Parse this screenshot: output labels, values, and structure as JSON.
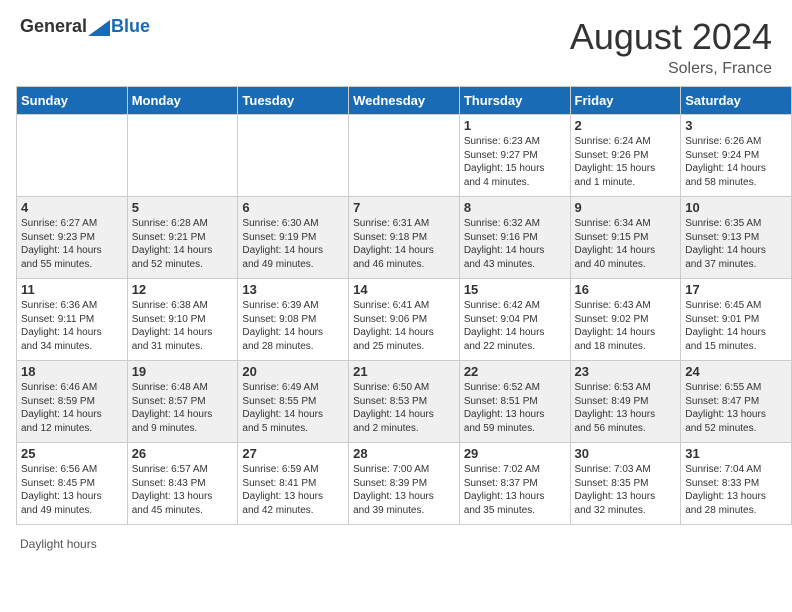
{
  "header": {
    "logo_general": "General",
    "logo_blue": "Blue",
    "month_year": "August 2024",
    "location": "Solers, France"
  },
  "days_of_week": [
    "Sunday",
    "Monday",
    "Tuesday",
    "Wednesday",
    "Thursday",
    "Friday",
    "Saturday"
  ],
  "footer": {
    "daylight_label": "Daylight hours"
  },
  "weeks": [
    {
      "days": [
        {
          "num": "",
          "info": ""
        },
        {
          "num": "",
          "info": ""
        },
        {
          "num": "",
          "info": ""
        },
        {
          "num": "",
          "info": ""
        },
        {
          "num": "1",
          "info": "Sunrise: 6:23 AM\nSunset: 9:27 PM\nDaylight: 15 hours\nand 4 minutes."
        },
        {
          "num": "2",
          "info": "Sunrise: 6:24 AM\nSunset: 9:26 PM\nDaylight: 15 hours\nand 1 minute."
        },
        {
          "num": "3",
          "info": "Sunrise: 6:26 AM\nSunset: 9:24 PM\nDaylight: 14 hours\nand 58 minutes."
        }
      ]
    },
    {
      "days": [
        {
          "num": "4",
          "info": "Sunrise: 6:27 AM\nSunset: 9:23 PM\nDaylight: 14 hours\nand 55 minutes."
        },
        {
          "num": "5",
          "info": "Sunrise: 6:28 AM\nSunset: 9:21 PM\nDaylight: 14 hours\nand 52 minutes."
        },
        {
          "num": "6",
          "info": "Sunrise: 6:30 AM\nSunset: 9:19 PM\nDaylight: 14 hours\nand 49 minutes."
        },
        {
          "num": "7",
          "info": "Sunrise: 6:31 AM\nSunset: 9:18 PM\nDaylight: 14 hours\nand 46 minutes."
        },
        {
          "num": "8",
          "info": "Sunrise: 6:32 AM\nSunset: 9:16 PM\nDaylight: 14 hours\nand 43 minutes."
        },
        {
          "num": "9",
          "info": "Sunrise: 6:34 AM\nSunset: 9:15 PM\nDaylight: 14 hours\nand 40 minutes."
        },
        {
          "num": "10",
          "info": "Sunrise: 6:35 AM\nSunset: 9:13 PM\nDaylight: 14 hours\nand 37 minutes."
        }
      ]
    },
    {
      "days": [
        {
          "num": "11",
          "info": "Sunrise: 6:36 AM\nSunset: 9:11 PM\nDaylight: 14 hours\nand 34 minutes."
        },
        {
          "num": "12",
          "info": "Sunrise: 6:38 AM\nSunset: 9:10 PM\nDaylight: 14 hours\nand 31 minutes."
        },
        {
          "num": "13",
          "info": "Sunrise: 6:39 AM\nSunset: 9:08 PM\nDaylight: 14 hours\nand 28 minutes."
        },
        {
          "num": "14",
          "info": "Sunrise: 6:41 AM\nSunset: 9:06 PM\nDaylight: 14 hours\nand 25 minutes."
        },
        {
          "num": "15",
          "info": "Sunrise: 6:42 AM\nSunset: 9:04 PM\nDaylight: 14 hours\nand 22 minutes."
        },
        {
          "num": "16",
          "info": "Sunrise: 6:43 AM\nSunset: 9:02 PM\nDaylight: 14 hours\nand 18 minutes."
        },
        {
          "num": "17",
          "info": "Sunrise: 6:45 AM\nSunset: 9:01 PM\nDaylight: 14 hours\nand 15 minutes."
        }
      ]
    },
    {
      "days": [
        {
          "num": "18",
          "info": "Sunrise: 6:46 AM\nSunset: 8:59 PM\nDaylight: 14 hours\nand 12 minutes."
        },
        {
          "num": "19",
          "info": "Sunrise: 6:48 AM\nSunset: 8:57 PM\nDaylight: 14 hours\nand 9 minutes."
        },
        {
          "num": "20",
          "info": "Sunrise: 6:49 AM\nSunset: 8:55 PM\nDaylight: 14 hours\nand 5 minutes."
        },
        {
          "num": "21",
          "info": "Sunrise: 6:50 AM\nSunset: 8:53 PM\nDaylight: 14 hours\nand 2 minutes."
        },
        {
          "num": "22",
          "info": "Sunrise: 6:52 AM\nSunset: 8:51 PM\nDaylight: 13 hours\nand 59 minutes."
        },
        {
          "num": "23",
          "info": "Sunrise: 6:53 AM\nSunset: 8:49 PM\nDaylight: 13 hours\nand 56 minutes."
        },
        {
          "num": "24",
          "info": "Sunrise: 6:55 AM\nSunset: 8:47 PM\nDaylight: 13 hours\nand 52 minutes."
        }
      ]
    },
    {
      "days": [
        {
          "num": "25",
          "info": "Sunrise: 6:56 AM\nSunset: 8:45 PM\nDaylight: 13 hours\nand 49 minutes."
        },
        {
          "num": "26",
          "info": "Sunrise: 6:57 AM\nSunset: 8:43 PM\nDaylight: 13 hours\nand 45 minutes."
        },
        {
          "num": "27",
          "info": "Sunrise: 6:59 AM\nSunset: 8:41 PM\nDaylight: 13 hours\nand 42 minutes."
        },
        {
          "num": "28",
          "info": "Sunrise: 7:00 AM\nSunset: 8:39 PM\nDaylight: 13 hours\nand 39 minutes."
        },
        {
          "num": "29",
          "info": "Sunrise: 7:02 AM\nSunset: 8:37 PM\nDaylight: 13 hours\nand 35 minutes."
        },
        {
          "num": "30",
          "info": "Sunrise: 7:03 AM\nSunset: 8:35 PM\nDaylight: 13 hours\nand 32 minutes."
        },
        {
          "num": "31",
          "info": "Sunrise: 7:04 AM\nSunset: 8:33 PM\nDaylight: 13 hours\nand 28 minutes."
        }
      ]
    }
  ]
}
